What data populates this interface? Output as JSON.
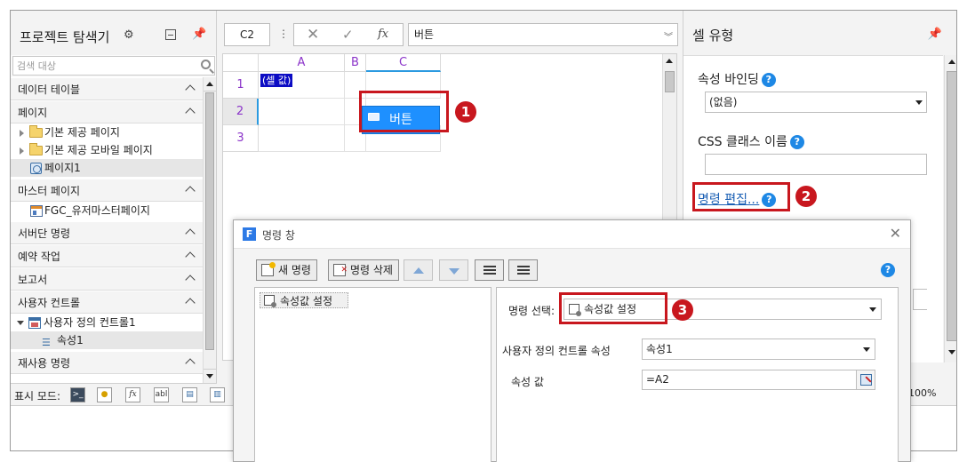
{
  "explorer": {
    "title": "프로젝트 탐색기",
    "search_placeholder": "검색 대상",
    "sections": {
      "data_tables": "데이터 테이블",
      "pages": "페이지",
      "master_pages": "마스터 페이지",
      "server_commands": "서버단 명령",
      "scheduled_tasks": "예약 작업",
      "reports": "보고서",
      "user_controls": "사용자 컨트롤",
      "reusable_commands": "재사용 명령"
    },
    "items": {
      "default_pages": "기본 제공 페이지",
      "default_mobile_pages": "기본 제공 모바일 페이지",
      "page1": "페이지1",
      "master_page": "FGC_유저마스터페이지",
      "user_control1": "사용자 정의 컨트롤1",
      "property1": "속성1"
    },
    "display_mode_label": "표시 모드:",
    "display_mode_fx": "fx",
    "display_mode_abl": "abl"
  },
  "formula_bar": {
    "cell_ref": "C2",
    "fx": "fx",
    "value": "버튼"
  },
  "sheet": {
    "columns": [
      "A",
      "B",
      "C"
    ],
    "rows": [
      "1",
      "2",
      "3"
    ],
    "cell_a1_tag": "(셀 값)",
    "button_label": "버튼"
  },
  "cell_type": {
    "title": "셀 유형",
    "property_binding_label": "속성 바인딩",
    "property_binding_value": "(없음)",
    "css_class_label": "CSS 클래스 이름",
    "edit_command_link": "명령 편집...",
    "zoom": "100%"
  },
  "callouts": [
    "1",
    "2",
    "3"
  ],
  "dialog": {
    "logo": "F",
    "title": "명령 창",
    "new_command": "새 명령",
    "delete_command": "명령 삭제",
    "command_list": [
      "속성값 설정"
    ],
    "command_select_label": "명령 선택:",
    "command_select_value": "속성값 설정",
    "control_property_label": "사용자 정의 컨트롤 속성",
    "control_property_value": "속성1",
    "property_value_label": "속성 값",
    "property_value": "=A2"
  },
  "colors": {
    "accent_blue": "#1e90ff",
    "callout_red": "#c8171e",
    "header_purple": "#8b34c9",
    "help_blue": "#1e88e5"
  }
}
